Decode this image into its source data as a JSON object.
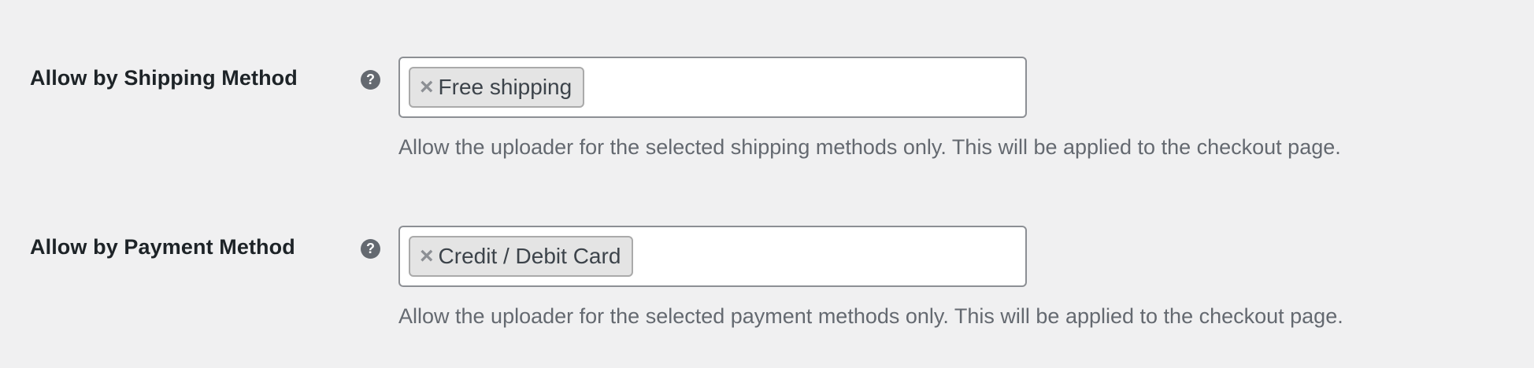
{
  "fields": [
    {
      "label": "Allow by Shipping Method",
      "help_icon": "question-circle-icon",
      "selected": "Free shipping",
      "remove_glyph": "×",
      "description": "Allow the uploader for the selected shipping methods only. This will be applied to the checkout page."
    },
    {
      "label": "Allow by Payment Method",
      "help_icon": "question-circle-icon",
      "selected": "Credit / Debit Card",
      "remove_glyph": "×",
      "description": "Allow the uploader for the selected payment methods only. This will be applied to the checkout page."
    }
  ],
  "help_glyph": "?",
  "colors": {
    "background": "#f0f0f1",
    "label_text": "#1d2327",
    "description_text": "#646970",
    "help_icon_bg": "#646970",
    "chip_bg": "#e4e4e4",
    "input_border": "#8c8f94"
  }
}
